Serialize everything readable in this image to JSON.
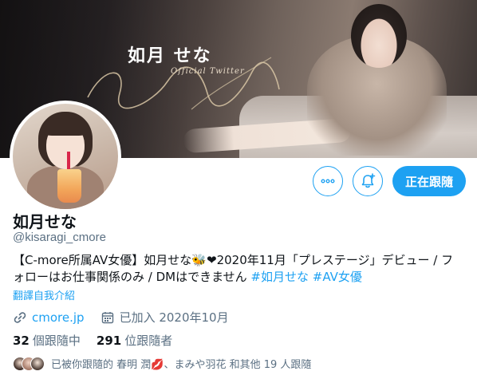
{
  "banner": {
    "title": "如月 せな",
    "subtitle": "Official Twitter"
  },
  "profile": {
    "name": "如月せな",
    "handle": "@kisaragi_cmore",
    "bio_prefix": "【C-more所属AV女優】如月せな",
    "bio_emojis": "🐝❤",
    "bio_main": "2020年11月「プレステージ」デビュー / フォローはお仕事関係のみ / DMはできません ",
    "hashtag_1": "#如月せな",
    "hashtag_2": "#AV女優",
    "translate_label": "翻譯自我介紹",
    "website": "cmore.jp",
    "joined": "已加入 2020年10月"
  },
  "actions": {
    "more_icon": "more-dots-icon",
    "notify_icon": "bell-plus-icon",
    "following_label": "正在跟隨"
  },
  "stats": {
    "following_count": "32",
    "following_label": "個跟隨中",
    "followers_count": "291",
    "followers_label": "位跟隨者"
  },
  "followed_by": {
    "text": "已被你跟隨的 春明 潤💋、まみや羽花 和其他 19 人跟隨"
  },
  "colors": {
    "accent": "#1da1f2",
    "text": "#0f1419",
    "secondary": "#5b7083"
  }
}
